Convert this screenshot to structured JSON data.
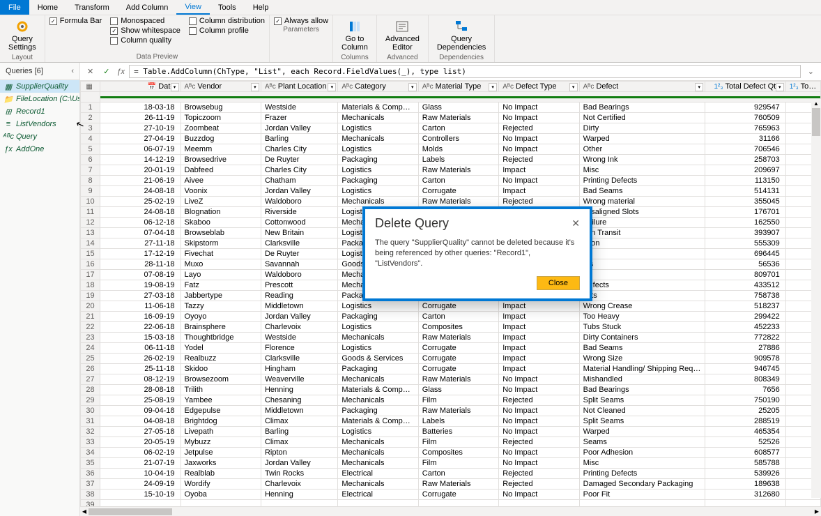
{
  "menu": {
    "file": "File",
    "home": "Home",
    "transform": "Transform",
    "addcol": "Add Column",
    "view": "View",
    "tools": "Tools",
    "help": "Help"
  },
  "ribbon": {
    "query_settings": "Query\nSettings",
    "layout": "Layout",
    "formula_bar": "Formula Bar",
    "monospaced": "Monospaced",
    "show_ws": "Show whitespace",
    "col_quality": "Column quality",
    "col_dist": "Column distribution",
    "col_profile": "Column profile",
    "data_preview": "Data Preview",
    "always_allow": "Always allow",
    "goto_col": "Go to\nColumn",
    "columns": "Columns",
    "adv_editor": "Advanced\nEditor",
    "parameters": "Parameters",
    "advanced": "Advanced",
    "query_deps": "Query\nDependencies",
    "dependencies": "Dependencies"
  },
  "queries": {
    "header": "Queries [6]",
    "items": [
      {
        "name": "SupplierQuality",
        "icon": "table"
      },
      {
        "name": "FileLocation (C:\\Users...",
        "icon": "param"
      },
      {
        "name": "Record1",
        "icon": "record"
      },
      {
        "name": "ListVendors",
        "icon": "list"
      },
      {
        "name": "Query",
        "icon": "abc"
      },
      {
        "name": "AddOne",
        "icon": "fx"
      }
    ]
  },
  "formula": "= Table.AddColumn(ChType, \"List\", each Record.FieldValues(_), type list)",
  "columns": {
    "date": "Date",
    "vendor": "Vendor",
    "plant": "Plant Location",
    "category": "Category",
    "material": "Material Type",
    "defecttype": "Defect Type",
    "defect": "Defect",
    "qty": "Total Defect Qty",
    "downtime": "Total Dov"
  },
  "rows": [
    {
      "n": 1,
      "date": "18-03-18",
      "vendor": "Browsebug",
      "plant": "Westside",
      "category": "Materials & Components",
      "material": "Glass",
      "defecttype": "No Impact",
      "defect": "Bad Bearings",
      "qty": "929547"
    },
    {
      "n": 2,
      "date": "26-11-19",
      "vendor": "Topiczoom",
      "plant": "Frazer",
      "category": "Mechanicals",
      "material": "Raw Materials",
      "defecttype": "No Impact",
      "defect": "Not Certified",
      "qty": "760509"
    },
    {
      "n": 3,
      "date": "27-10-19",
      "vendor": "Zoombeat",
      "plant": "Jordan Valley",
      "category": "Logistics",
      "material": "Carton",
      "defecttype": "Rejected",
      "defect": "Dirty",
      "qty": "765963"
    },
    {
      "n": 4,
      "date": "27-04-19",
      "vendor": "Buzzdog",
      "plant": "Barling",
      "category": "Mechanicals",
      "material": "Controllers",
      "defecttype": "No Impact",
      "defect": "Warped",
      "qty": "31166"
    },
    {
      "n": 5,
      "date": "06-07-19",
      "vendor": "Meemm",
      "plant": "Charles City",
      "category": "Logistics",
      "material": "Molds",
      "defecttype": "No Impact",
      "defect": "Other",
      "qty": "706546"
    },
    {
      "n": 6,
      "date": "14-12-19",
      "vendor": "Browsedrive",
      "plant": "De Ruyter",
      "category": "Packaging",
      "material": "Labels",
      "defecttype": "Rejected",
      "defect": "Wrong Ink",
      "qty": "258703"
    },
    {
      "n": 7,
      "date": "20-01-19",
      "vendor": "Dabfeed",
      "plant": "Charles City",
      "category": "Logistics",
      "material": "Raw Materials",
      "defecttype": "Impact",
      "defect": "Misc",
      "qty": "209697"
    },
    {
      "n": 8,
      "date": "21-06-19",
      "vendor": "Aivee",
      "plant": "Chatham",
      "category": "Packaging",
      "material": "Carton",
      "defecttype": "No Impact",
      "defect": "Printing Defects",
      "qty": "113150"
    },
    {
      "n": 9,
      "date": "24-08-18",
      "vendor": "Voonix",
      "plant": "Jordan Valley",
      "category": "Logistics",
      "material": "Corrugate",
      "defecttype": "Impact",
      "defect": "Bad Seams",
      "qty": "514131"
    },
    {
      "n": 10,
      "date": "25-02-19",
      "vendor": "LiveZ",
      "plant": "Waldoboro",
      "category": "Mechanicals",
      "material": "Raw Materials",
      "defecttype": "Rejected",
      "defect": "Wrong material",
      "qty": "355045"
    },
    {
      "n": 11,
      "date": "24-08-18",
      "vendor": "Blognation",
      "plant": "Riverside",
      "category": "Logistics",
      "material": "",
      "defecttype": "",
      "defect": "Misaligned Slots",
      "qty": "176701"
    },
    {
      "n": 12,
      "date": "06-12-18",
      "vendor": "Skaboo",
      "plant": "Cottonwood",
      "category": "Mechanic",
      "material": "",
      "defecttype": "",
      "defect": "Failure",
      "qty": "162550"
    },
    {
      "n": 13,
      "date": "07-04-18",
      "vendor": "Browseblab",
      "plant": "New Britain",
      "category": "Logistics",
      "material": "",
      "defecttype": "",
      "defect": "d in Transit",
      "qty": "393907"
    },
    {
      "n": 14,
      "date": "27-11-18",
      "vendor": "Skipstorm",
      "plant": "Clarksville",
      "category": "Packaging",
      "material": "",
      "defecttype": "",
      "defect": "ation",
      "qty": "555309"
    },
    {
      "n": 15,
      "date": "17-12-19",
      "vendor": "Fivechat",
      "plant": "De Ruyter",
      "category": "Logistics",
      "material": "",
      "defecttype": "",
      "defect": "ck",
      "qty": "696445"
    },
    {
      "n": 16,
      "date": "28-11-18",
      "vendor": "Muxo",
      "plant": "Savannah",
      "category": "Goods & S",
      "material": "",
      "defecttype": "",
      "defect": "ms",
      "qty": "56536"
    },
    {
      "n": 17,
      "date": "07-08-19",
      "vendor": "Layo",
      "plant": "Waldoboro",
      "category": "Mechanic",
      "material": "",
      "defecttype": "",
      "defect": "",
      "qty": "809701"
    },
    {
      "n": 18,
      "date": "19-08-19",
      "vendor": "Fatz",
      "plant": "Prescott",
      "category": "Mechanic",
      "material": "",
      "defecttype": "",
      "defect": "Defects",
      "qty": "433512"
    },
    {
      "n": 19,
      "date": "27-03-18",
      "vendor": "Jabbertype",
      "plant": "Reading",
      "category": "Packaging",
      "material": "",
      "defecttype": "",
      "defect": "ects",
      "qty": "758738"
    },
    {
      "n": 20,
      "date": "11-06-18",
      "vendor": "Tazzy",
      "plant": "Middletown",
      "category": "Logistics",
      "material": "Corrugate",
      "defecttype": "Impact",
      "defect": "Wrong Crease",
      "qty": "518237"
    },
    {
      "n": 21,
      "date": "16-09-19",
      "vendor": "Oyoyo",
      "plant": "Jordan Valley",
      "category": "Packaging",
      "material": "Carton",
      "defecttype": "Impact",
      "defect": "Too Heavy",
      "qty": "299422"
    },
    {
      "n": 22,
      "date": "22-06-18",
      "vendor": "Brainsphere",
      "plant": "Charlevoix",
      "category": "Logistics",
      "material": "Composites",
      "defecttype": "Impact",
      "defect": "Tubs Stuck",
      "qty": "452233"
    },
    {
      "n": 23,
      "date": "15-03-18",
      "vendor": "Thoughtbridge",
      "plant": "Westside",
      "category": "Mechanicals",
      "material": "Raw Materials",
      "defecttype": "Impact",
      "defect": "Dirty Containers",
      "qty": "772822"
    },
    {
      "n": 24,
      "date": "06-11-18",
      "vendor": "Yodel",
      "plant": "Florence",
      "category": "Logistics",
      "material": "Corrugate",
      "defecttype": "Impact",
      "defect": "Bad Seams",
      "qty": "27886"
    },
    {
      "n": 25,
      "date": "26-02-19",
      "vendor": "Realbuzz",
      "plant": "Clarksville",
      "category": "Goods & Services",
      "material": "Corrugate",
      "defecttype": "Impact",
      "defect": "Wrong  Size",
      "qty": "909578"
    },
    {
      "n": 26,
      "date": "25-11-18",
      "vendor": "Skidoo",
      "plant": "Hingham",
      "category": "Packaging",
      "material": "Corrugate",
      "defecttype": "Impact",
      "defect": "Material Handling/ Shipping Requirements Error",
      "qty": "946745"
    },
    {
      "n": 27,
      "date": "08-12-19",
      "vendor": "Browsezoom",
      "plant": "Weaverville",
      "category": "Mechanicals",
      "material": "Raw Materials",
      "defecttype": "No Impact",
      "defect": "Mishandled",
      "qty": "808349"
    },
    {
      "n": 28,
      "date": "28-08-18",
      "vendor": "Trilith",
      "plant": "Henning",
      "category": "Materials & Components",
      "material": "Glass",
      "defecttype": "No Impact",
      "defect": "Bad Bearings",
      "qty": "7656"
    },
    {
      "n": 29,
      "date": "25-08-19",
      "vendor": "Yambee",
      "plant": "Chesaning",
      "category": "Mechanicals",
      "material": "Film",
      "defecttype": "Rejected",
      "defect": "Split Seams",
      "qty": "750190"
    },
    {
      "n": 30,
      "date": "09-04-18",
      "vendor": "Edgepulse",
      "plant": "Middletown",
      "category": "Packaging",
      "material": "Raw Materials",
      "defecttype": "No Impact",
      "defect": "Not Cleaned",
      "qty": "25205"
    },
    {
      "n": 31,
      "date": "04-08-18",
      "vendor": "Brightdog",
      "plant": "Climax",
      "category": "Materials & Components",
      "material": "Labels",
      "defecttype": "No Impact",
      "defect": "Split Seams",
      "qty": "288519"
    },
    {
      "n": 32,
      "date": "27-05-18",
      "vendor": "Livepath",
      "plant": "Barling",
      "category": "Logistics",
      "material": "Batteries",
      "defecttype": "No Impact",
      "defect": "Warped",
      "qty": "465354"
    },
    {
      "n": 33,
      "date": "20-05-19",
      "vendor": "Mybuzz",
      "plant": "Climax",
      "category": "Mechanicals",
      "material": "Film",
      "defecttype": "Rejected",
      "defect": "Seams",
      "qty": "52526"
    },
    {
      "n": 34,
      "date": "06-02-19",
      "vendor": "Jetpulse",
      "plant": "Ripton",
      "category": "Mechanicals",
      "material": "Composites",
      "defecttype": "No Impact",
      "defect": "Poor  Adhesion",
      "qty": "608577"
    },
    {
      "n": 35,
      "date": "21-07-19",
      "vendor": "Jaxworks",
      "plant": "Jordan Valley",
      "category": "Mechanicals",
      "material": "Film",
      "defecttype": "No Impact",
      "defect": "Misc",
      "qty": "585788"
    },
    {
      "n": 36,
      "date": "10-04-19",
      "vendor": "Realblab",
      "plant": "Twin Rocks",
      "category": "Electrical",
      "material": "Carton",
      "defecttype": "Rejected",
      "defect": "Printing Defects",
      "qty": "539926"
    },
    {
      "n": 37,
      "date": "24-09-19",
      "vendor": "Wordify",
      "plant": "Charlevoix",
      "category": "Mechanicals",
      "material": "Raw Materials",
      "defecttype": "Rejected",
      "defect": "Damaged Secondary Packaging",
      "qty": "189638"
    },
    {
      "n": 38,
      "date": "15-10-19",
      "vendor": "Oyoba",
      "plant": "Henning",
      "category": "Electrical",
      "material": "Corrugate",
      "defecttype": "No Impact",
      "defect": "Poor Fit",
      "qty": "312680"
    },
    {
      "n": 39,
      "date": "",
      "vendor": "",
      "plant": "",
      "category": "",
      "material": "",
      "defecttype": "",
      "defect": "",
      "qty": ""
    }
  ],
  "dialog": {
    "title": "Delete Query",
    "body": "The query \"SupplierQuality\" cannot be deleted because it's being referenced by other queries: \"Record1\", \"ListVendors\".",
    "close": "Close"
  }
}
